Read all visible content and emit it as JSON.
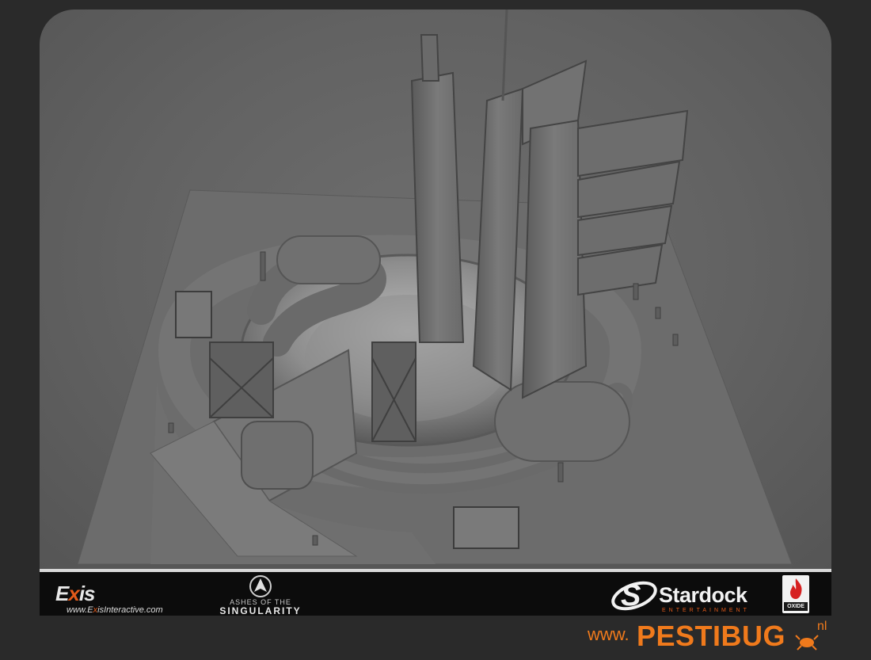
{
  "render": {
    "subject": "untextured grey 3D building model",
    "background_color": "#2a2a2a"
  },
  "footer": {
    "exis": {
      "logo_prefix": "E",
      "logo_x": "x",
      "logo_suffix": "is",
      "url_prefix": "www.E",
      "url_x": "x",
      "url_suffix": "isInteractive.com"
    },
    "game": {
      "line1": "ASHES OF THE",
      "line2": "SINGULARITY"
    },
    "stardock": {
      "name": "Stardock",
      "sub": "ENTERTAINMENT"
    },
    "oxide": {
      "label": "OXIDE"
    }
  },
  "watermark": {
    "www": "www.",
    "brand": "PESTIBUG",
    "tld": "nl"
  },
  "colors": {
    "exis_accent": "#e35a1a",
    "watermark": "#f07a1c",
    "footer_bg": "#0c0c0c"
  },
  "icons": [
    "ashes-emblem-icon",
    "stardock-swoosh-icon",
    "oxide-flame-icon",
    "bug-icon"
  ]
}
